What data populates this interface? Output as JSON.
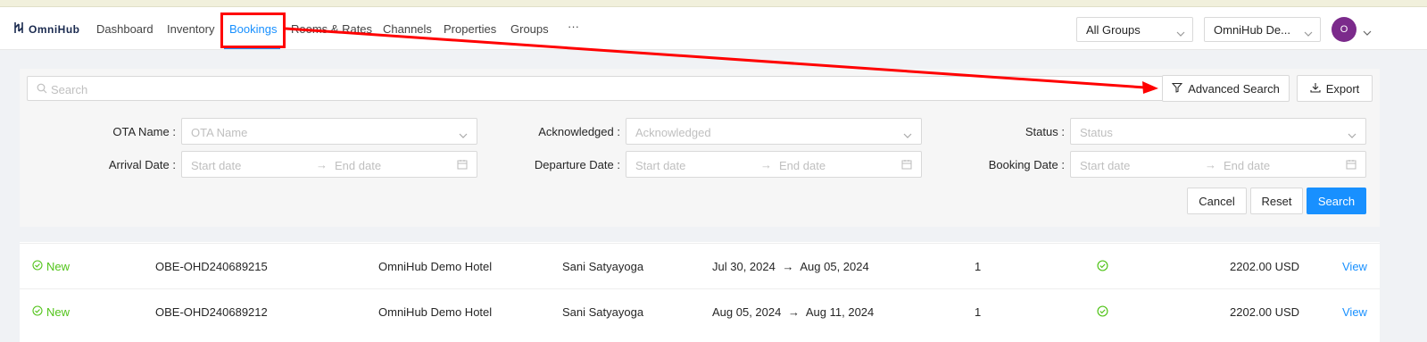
{
  "app": {
    "logo_text": "OmniHub",
    "brand_color": "#1890ff",
    "logo_color": "#1a2a4f"
  },
  "nav": {
    "items": [
      {
        "label": "Dashboard"
      },
      {
        "label": "Inventory"
      },
      {
        "label": "Bookings",
        "active": true
      },
      {
        "label": "Rooms & Rates"
      },
      {
        "label": "Channels"
      },
      {
        "label": "Properties"
      },
      {
        "label": "Groups"
      }
    ],
    "more": "···"
  },
  "header": {
    "group_select": "All Groups",
    "property_select": "OmniHub De...",
    "avatar_initial": "O",
    "avatar_color": "#7b2a8b"
  },
  "search": {
    "placeholder": "Search",
    "advanced_label": "Advanced Search",
    "export_label": "Export"
  },
  "filters": {
    "ota_name": {
      "label": "OTA Name",
      "placeholder": "OTA Name"
    },
    "acknowledged": {
      "label": "Acknowledged",
      "placeholder": "Acknowledged"
    },
    "status": {
      "label": "Status",
      "placeholder": "Status"
    },
    "arrival_date": {
      "label": "Arrival Date",
      "start": "Start date",
      "end": "End date"
    },
    "departure_date": {
      "label": "Departure Date",
      "start": "Start date",
      "end": "End date"
    },
    "booking_date": {
      "label": "Booking Date",
      "start": "Start date",
      "end": "End date"
    },
    "separator": ":"
  },
  "actions": {
    "cancel": "Cancel",
    "reset": "Reset",
    "search": "Search"
  },
  "bookings": [
    {
      "status": "New",
      "id": "OBE-OHD240689215",
      "property": "OmniHub Demo Hotel",
      "guest": "Sani Satyayoga",
      "arrival": "Jul 30, 2024",
      "departure": "Aug 05, 2024",
      "rooms": "1",
      "amount": "2202.00 USD",
      "action": "View"
    },
    {
      "status": "New",
      "id": "OBE-OHD240689212",
      "property": "OmniHub Demo Hotel",
      "guest": "Sani Satyayoga",
      "arrival": "Aug 05, 2024",
      "departure": "Aug 11, 2024",
      "rooms": "1",
      "amount": "2202.00 USD",
      "action": "View"
    }
  ],
  "date_arrow": "→",
  "colors": {
    "status_new": "#52c41a",
    "annotation": "#ff0000"
  }
}
